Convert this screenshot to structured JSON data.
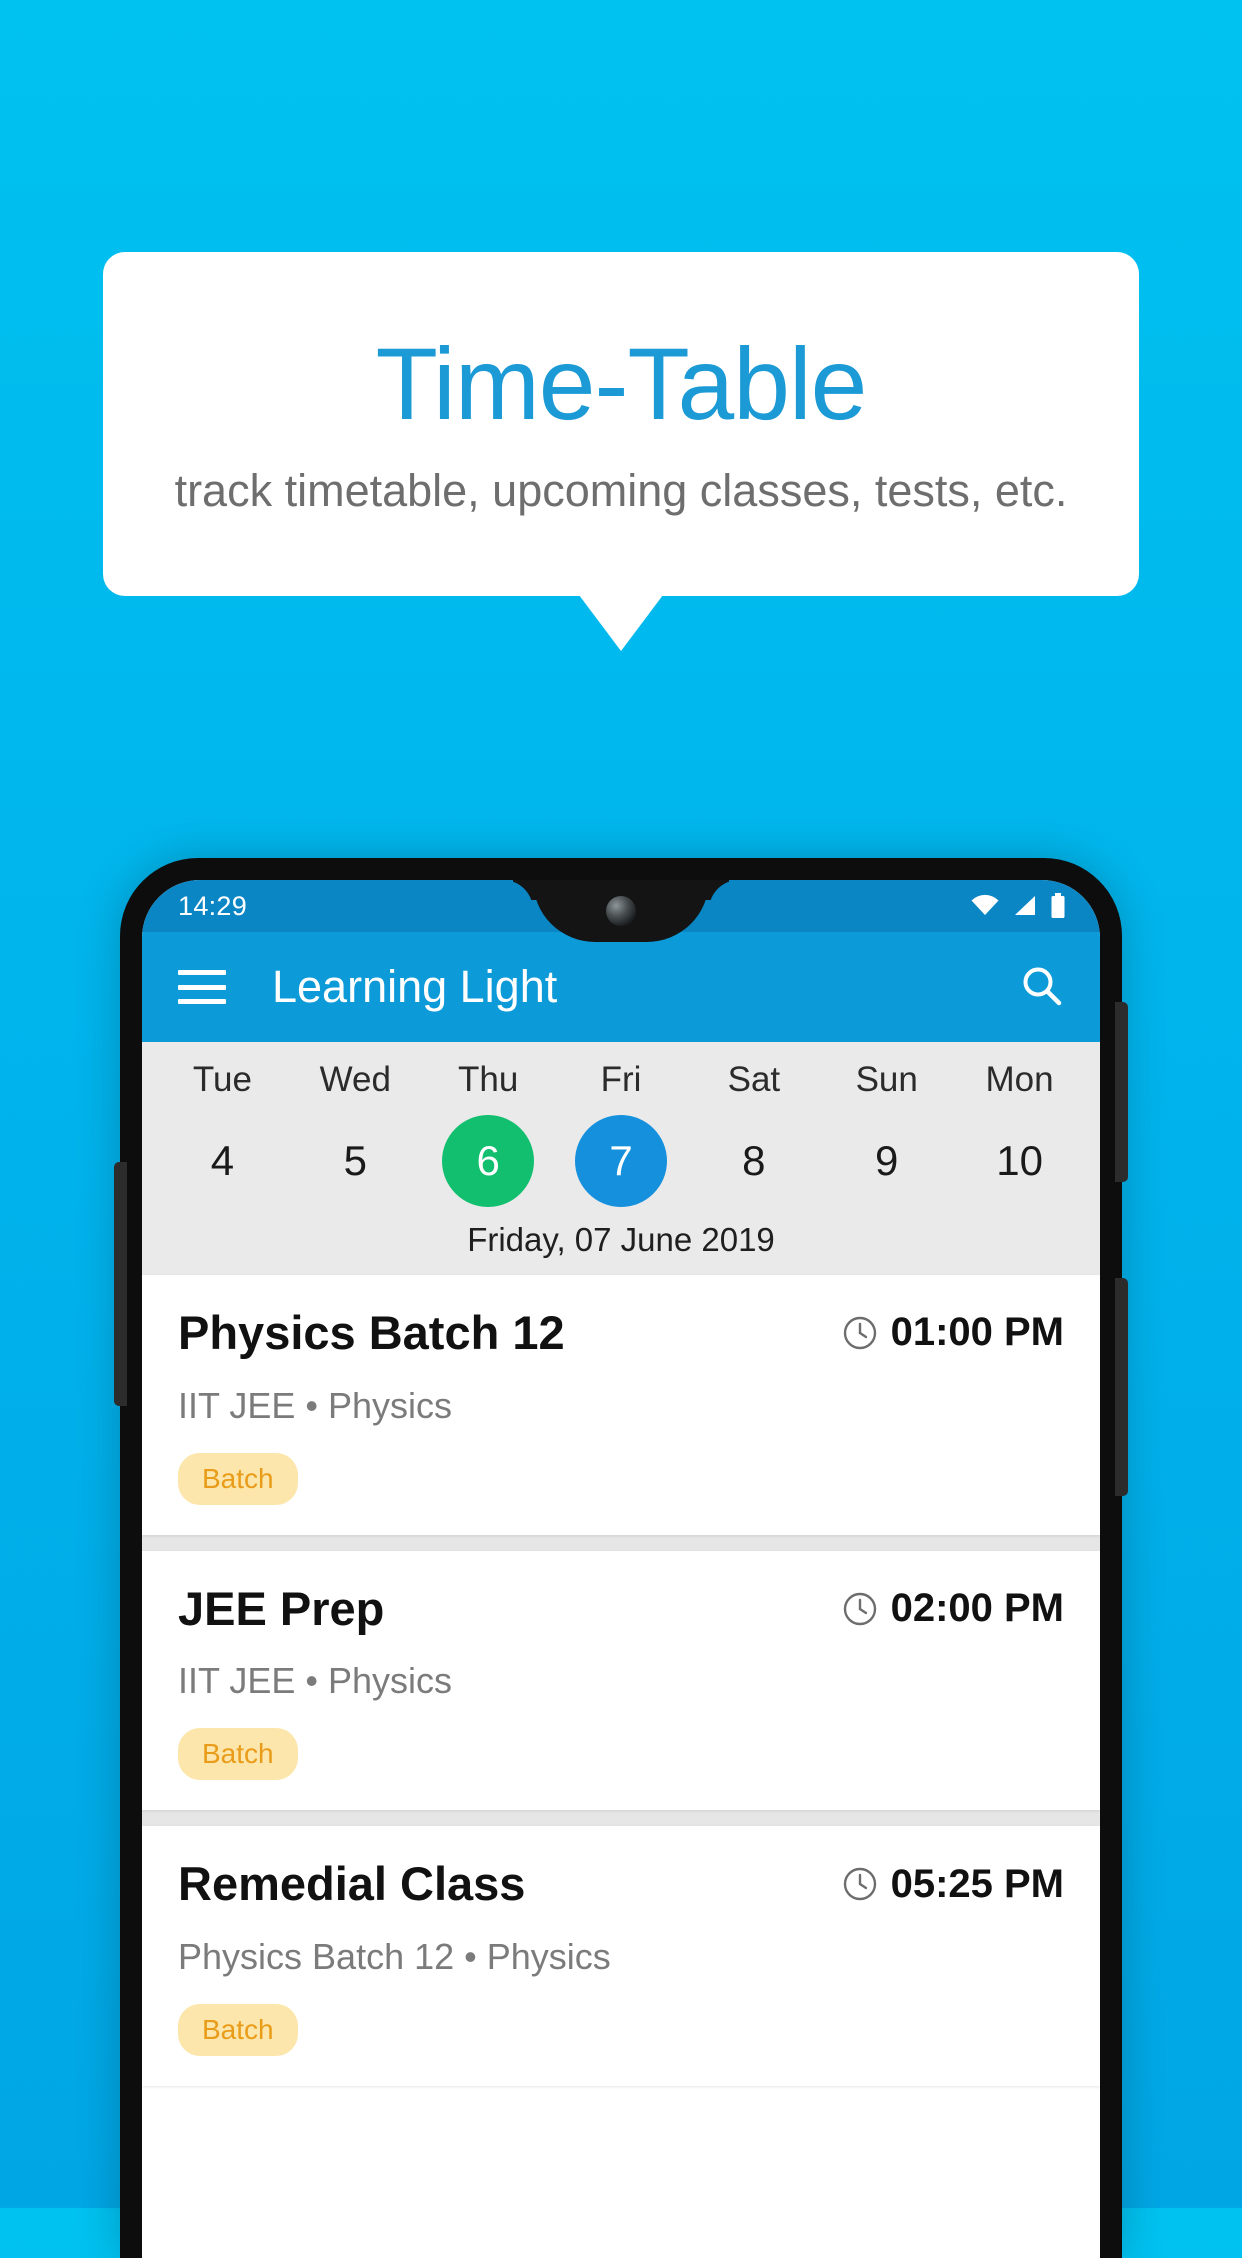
{
  "promo": {
    "title": "Time-Table",
    "subtitle": "track timetable, upcoming classes, tests, etc."
  },
  "phone": {
    "statusbar": {
      "time": "14:29",
      "icons": [
        "wifi-icon",
        "signal-icon",
        "battery-icon"
      ]
    },
    "appbar": {
      "menu_icon": "hamburger-menu-icon",
      "title": "Learning Light",
      "search_icon": "search-icon"
    },
    "datestrip": {
      "days": [
        {
          "name": "Tue",
          "num": "4",
          "state": "none"
        },
        {
          "name": "Wed",
          "num": "5",
          "state": "none"
        },
        {
          "name": "Thu",
          "num": "6",
          "state": "today"
        },
        {
          "name": "Fri",
          "num": "7",
          "state": "selected"
        },
        {
          "name": "Sat",
          "num": "8",
          "state": "none"
        },
        {
          "name": "Sun",
          "num": "9",
          "state": "none"
        },
        {
          "name": "Mon",
          "num": "10",
          "state": "none"
        }
      ],
      "selected_date": "Friday, 07 June 2019"
    },
    "events": [
      {
        "title": "Physics Batch 12",
        "time": "01:00 PM",
        "subtitle": "IIT JEE • Physics",
        "chip": "Batch",
        "clock_icon": "clock-icon"
      },
      {
        "title": "JEE Prep",
        "time": "02:00 PM",
        "subtitle": "IIT JEE • Physics",
        "chip": "Batch",
        "clock_icon": "clock-icon"
      },
      {
        "title": "Remedial Class",
        "time": "05:25 PM",
        "subtitle": "Physics Batch 12 • Physics",
        "chip": "Batch",
        "clock_icon": "clock-icon"
      }
    ]
  },
  "colors": {
    "background_top": "#00c2f0",
    "background_bottom": "#00a6e4",
    "promo_title": "#1b9ad6",
    "appbar": "#0d9ad8",
    "statusbar": "#0b86c4",
    "today_dot": "#11bf6e",
    "selected_dot": "#1490dd",
    "chip_bg": "#fce6ab",
    "chip_text": "#e99c19"
  }
}
